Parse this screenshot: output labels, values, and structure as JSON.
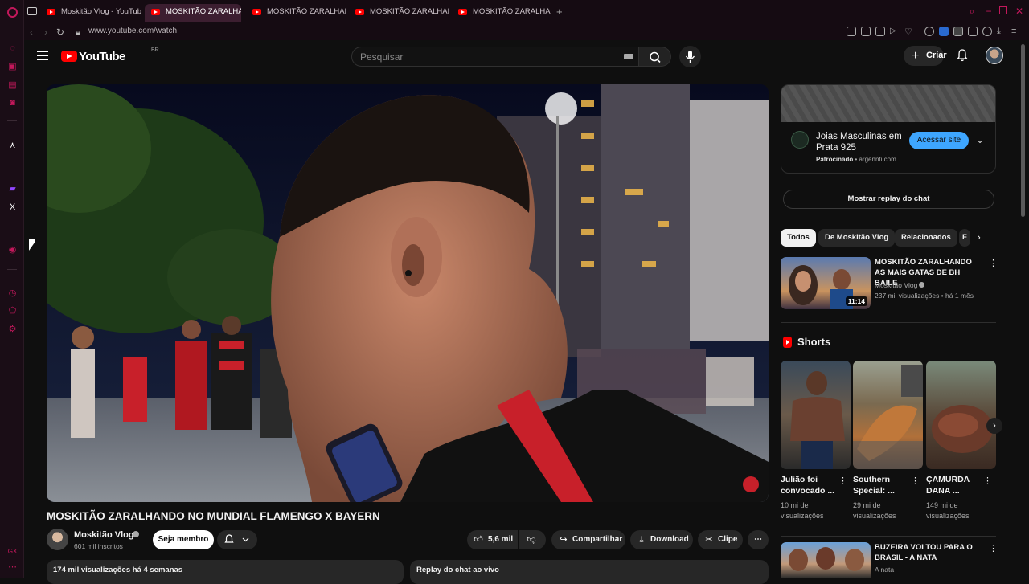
{
  "browser": {
    "tabs": [
      {
        "label": "Moskitão Vlog - YouTube",
        "active": false
      },
      {
        "label": "MOSKITÃO ZARALHA",
        "active": true
      },
      {
        "label": "MOSKITÃO ZARALHANDO",
        "active": false
      },
      {
        "label": "MOSKITÃO ZARALHANDO",
        "active": false
      },
      {
        "label": "MOSKITÃO ZARALHANDO",
        "active": false
      }
    ],
    "new_tab_icon": "plus-icon",
    "url": "www.youtube.com/watch",
    "accent_color": "#c2185b"
  },
  "youtube": {
    "logo_text": "YouTube",
    "region": "BR",
    "search_placeholder": "Pesquisar",
    "create_label": "Criar"
  },
  "video": {
    "title": "MOSKITÃO ZARALHANDO NO MUNDIAL FLAMENGO X BAYERN",
    "channel": "Moskitão Vlog",
    "subscribers": "601 mil inscritos",
    "join_label": "Seja membro",
    "likes": "5,6 mil",
    "share_label": "Compartilhar",
    "download_label": "Download",
    "clip_label": "Clipe",
    "stats": "174 mil visualizações  há 4 semanas",
    "chat_replay_label": "Replay do chat ao vivo"
  },
  "ad": {
    "title": "Joias Masculinas em Prata 925",
    "sponsored": "Patrocinado",
    "domain": "argennti.com...",
    "cta": "Acessar site",
    "cta_color": "#3ea6ff"
  },
  "sidebar": {
    "show_chat_label": "Mostrar replay do chat",
    "chips": [
      "Todos",
      "De Moskitão Vlog",
      "Relacionados",
      "F"
    ],
    "recommendations": [
      {
        "title": "MOSKITÃO ZARALHANDO AS MAIS GATAS DE BH BAILE",
        "channel": "Moskitão Vlog",
        "meta": "237 mil visualizações • há 1 mês",
        "duration": "11:14"
      },
      {
        "title": "BUZEIRA VOLTOU PARA O BRASIL - A NATA",
        "channel": "A nata"
      }
    ],
    "shorts_heading": "Shorts",
    "shorts": [
      {
        "title": "Julião foi convocado ...",
        "views": "10 mi de visualizações"
      },
      {
        "title": "Southern Special: ...",
        "views": "29 mi de visualizações"
      },
      {
        "title": "ÇAMURDA DANA ...",
        "views": "149 mi de visualizações"
      }
    ]
  }
}
